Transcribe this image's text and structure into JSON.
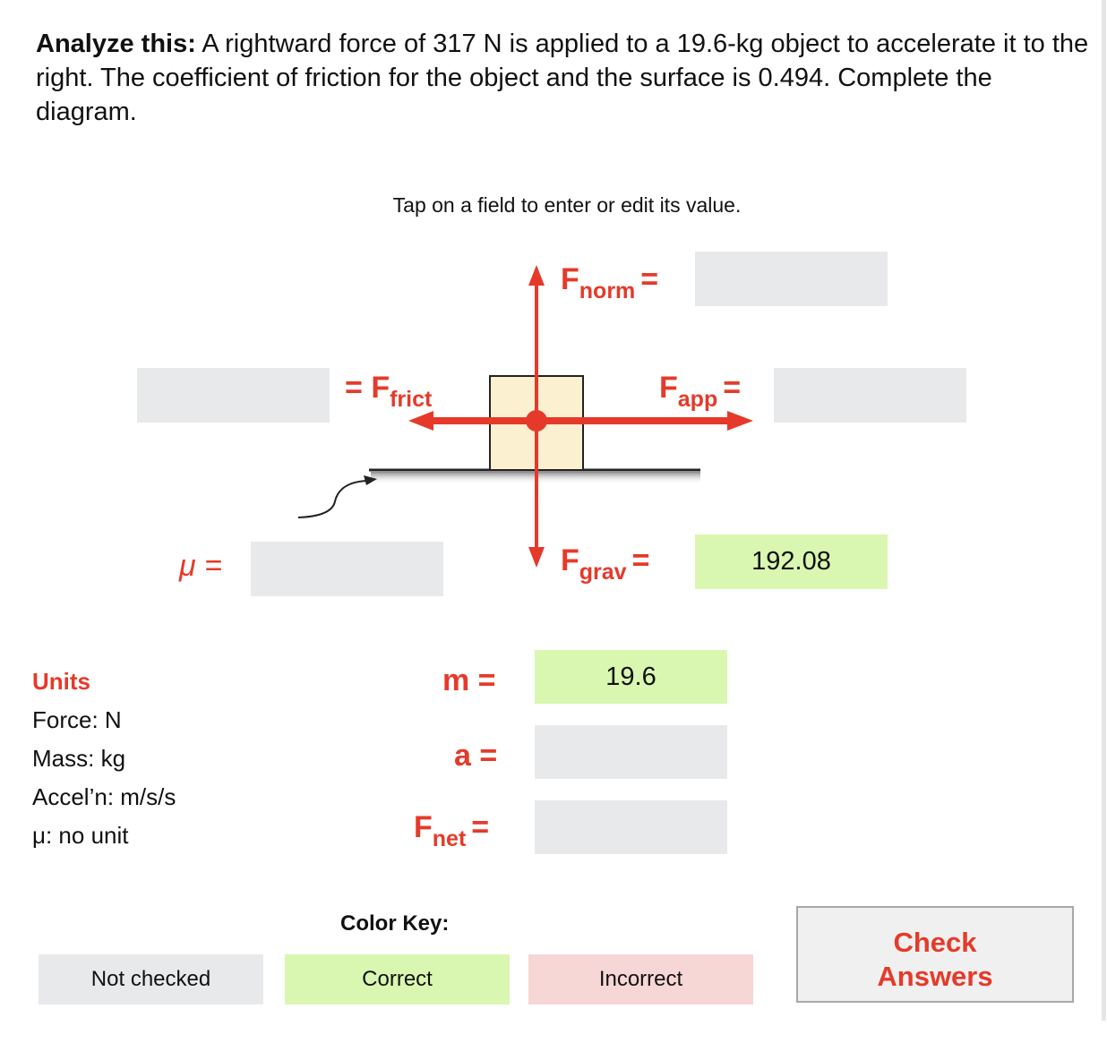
{
  "prompt": {
    "lead": "Analyze this:",
    "text": " A rightward force of 317 N is applied to a 19.6-kg object to accelerate it to the right. The coefficient of friction for the object and the surface is 0.494. Complete the diagram."
  },
  "instruction": "Tap on a field to enter or edit its value.",
  "labels": {
    "fnorm": {
      "main": "F",
      "sub": "norm",
      "eq": "="
    },
    "ffrict": {
      "eq": "=",
      "main": "F",
      "sub": "frict"
    },
    "fapp": {
      "main": "F",
      "sub": "app",
      "eq": "="
    },
    "fgrav": {
      "main": "F",
      "sub": "grav",
      "eq": "="
    },
    "mu": "μ =",
    "m": "m =",
    "a": "a =",
    "fnet": {
      "main": "F",
      "sub": "net",
      "eq": "="
    }
  },
  "fields": {
    "fnorm": "",
    "ffrict": "",
    "fapp": "",
    "fgrav": "192.08",
    "mu": "",
    "m": "19.6",
    "a": "",
    "fnet": ""
  },
  "units": {
    "title": "Units",
    "items": [
      "Force: N",
      "Mass: kg",
      "Accel’n: m/s/s",
      "μ: no unit"
    ]
  },
  "color_key": {
    "title": "Color Key:",
    "not_checked": "Not checked",
    "correct": "Correct",
    "incorrect": "Incorrect"
  },
  "check_button": "Check Answers",
  "colors": {
    "accent_red": "#e53a2a",
    "field_gray": "#e8e9eb",
    "correct_green": "#d9f7b0",
    "incorrect_pink": "#f7d6d6",
    "box_fill": "#fbf0d0"
  }
}
